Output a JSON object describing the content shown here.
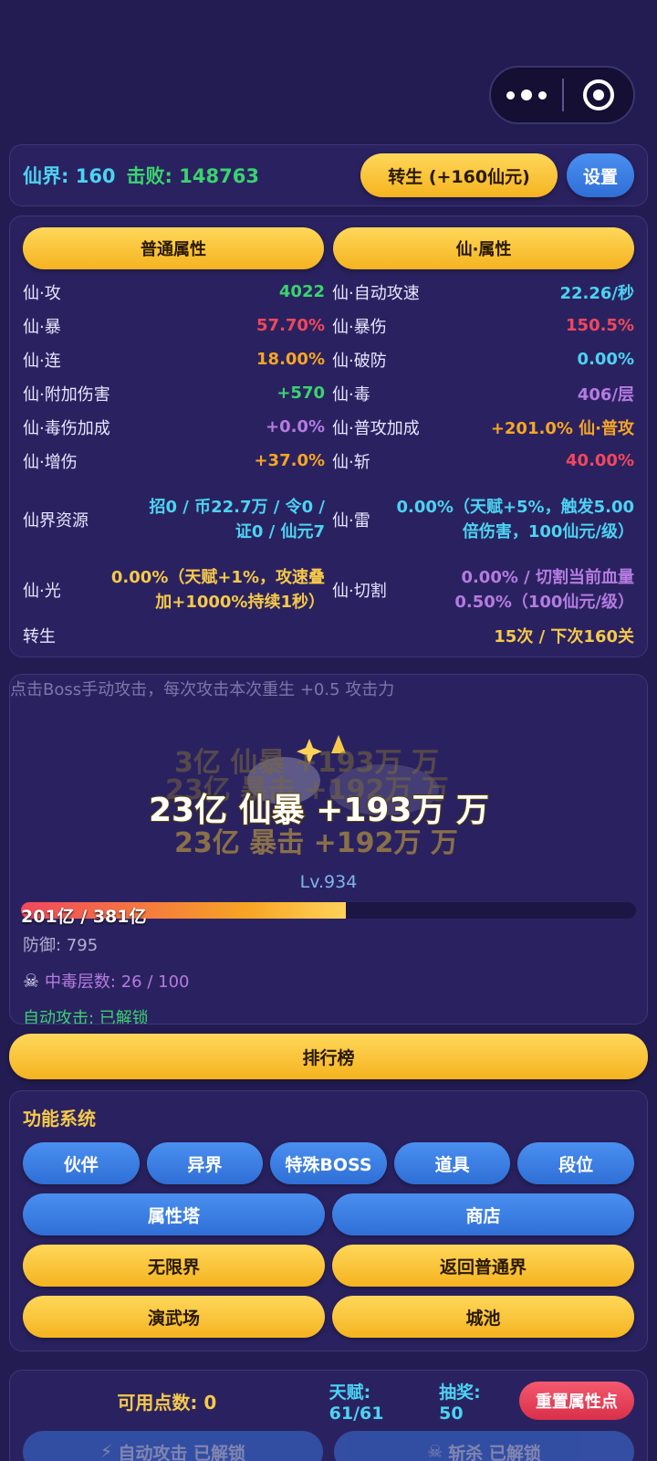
{
  "header": {
    "realm": "仙界: 160",
    "defeat": "击败: 148763",
    "rebirth_button": "转生 (+160仙元)",
    "settings_button": "设置"
  },
  "tabs": [
    "普通属性",
    "仙·属性"
  ],
  "stats": [
    {
      "k": "仙·攻",
      "v": "4022",
      "c": "green"
    },
    {
      "k": "仙·自动攻速",
      "v": "22.26/秒",
      "c": "cyan"
    },
    {
      "k": "仙·暴",
      "v": "57.70%",
      "c": "red"
    },
    {
      "k": "仙·暴伤",
      "v": "150.5%",
      "c": "red"
    },
    {
      "k": "仙·连",
      "v": "18.00%",
      "c": "orange"
    },
    {
      "k": "仙·破防",
      "v": "0.00%",
      "c": "cyan"
    },
    {
      "k": "仙·附加伤害",
      "v": "+570",
      "c": "green"
    },
    {
      "k": "仙·毒",
      "v": "406/层",
      "c": "purple"
    },
    {
      "k": "仙·毒伤加成",
      "v": "+0.0%",
      "c": "purple"
    },
    {
      "k": "仙·普攻加成",
      "v": "+201.0% 仙·普攻",
      "c": "orange"
    },
    {
      "k": "仙·增伤",
      "v": "+37.0%",
      "c": "orange"
    },
    {
      "k": "仙·斩",
      "v": "40.00%",
      "c": "red"
    },
    {
      "k": "仙界资源",
      "v": "招0 / 币22.7万 / 令0 / 证0 / 仙元7",
      "c": "cyan"
    },
    {
      "k": "仙·雷",
      "v": "0.00%（天赋+5%，触发5.00倍伤害，100仙元/级）",
      "c": "cyan"
    },
    {
      "k": "仙·光",
      "v": "0.00%（天赋+1%，攻速叠加+1000%持续1秒）",
      "c": "yellow"
    },
    {
      "k": "仙·切割",
      "v": "0.00% / 切割当前血量0.50%（100仙元/级）",
      "c": "purple"
    }
  ],
  "rebirth_row": {
    "k": "转生",
    "v": "15次 / 下次160关"
  },
  "boss": {
    "hint": "点击Boss手动攻击，每次攻击本次重生 +0.5 攻击力",
    "damage_text": "23亿 仙暴 +193万 万",
    "level": "Lv.934",
    "hp_text": "201亿 / 381亿",
    "hp_fraction": 0.5276,
    "defense": "防御: 795",
    "poison": "中毒层数: 26 / 100",
    "auto_attack": "自动攻击: 已解锁"
  },
  "rank_button": "排行榜",
  "functions": {
    "title": "功能系统",
    "row1": [
      "伙伴",
      "异界",
      "特殊BOSS",
      "道具",
      "段位"
    ],
    "row2": [
      "属性塔",
      "商店"
    ],
    "row3": [
      "无限界",
      "返回普通界"
    ],
    "row4": [
      "演武场",
      "城池"
    ]
  },
  "bottom": {
    "points": "可用点数: 0",
    "talent": "天赋: 61/61",
    "lottery": "抽奖: 50",
    "reset": "重置属性点",
    "auto_attack": "自动攻击 已解锁",
    "execute": "斩杀 已解锁"
  },
  "colors": {
    "background": "#231c52",
    "panel": "#2a2260",
    "gold": "#f5b320",
    "blue": "#2f6fd6",
    "green": "#3ad36f",
    "cyan": "#4cd3f2",
    "red": "#f2475d"
  }
}
